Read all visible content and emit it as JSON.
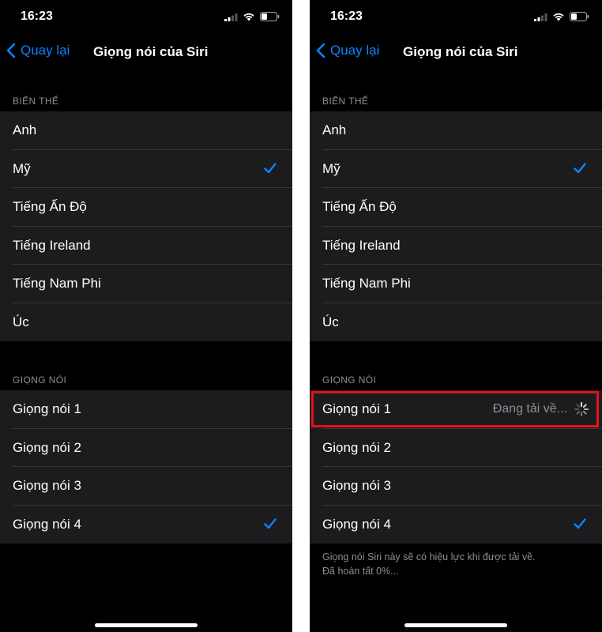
{
  "status_bar": {
    "time": "16:23"
  },
  "nav": {
    "back_label": "Quay lại",
    "title": "Giọng nói của Siri"
  },
  "variants": {
    "header": "BIẾN THỂ",
    "items": [
      "Anh",
      "Mỹ",
      "Tiếng Ấn Độ",
      "Tiếng Ireland",
      "Tiếng Nam Phi",
      "Úc"
    ],
    "selected": "Mỹ"
  },
  "voices": {
    "header": "GIỌNG NÓI",
    "items": [
      "Giọng nói 1",
      "Giọng nói 2",
      "Giọng nói 3",
      "Giọng nói 4"
    ],
    "selected": "Giọng nói 4"
  },
  "download": {
    "status": "Đang tải về...",
    "footer_line1": "Giọng nói Siri này sẽ có hiệu lực khi được tải về.",
    "footer_line2": "Đã hoàn tất 0%..."
  },
  "colors": {
    "accent": "#0a84ff",
    "highlight": "#e0131a",
    "cell_bg": "#1c1c1e",
    "page_bg": "#000000"
  }
}
